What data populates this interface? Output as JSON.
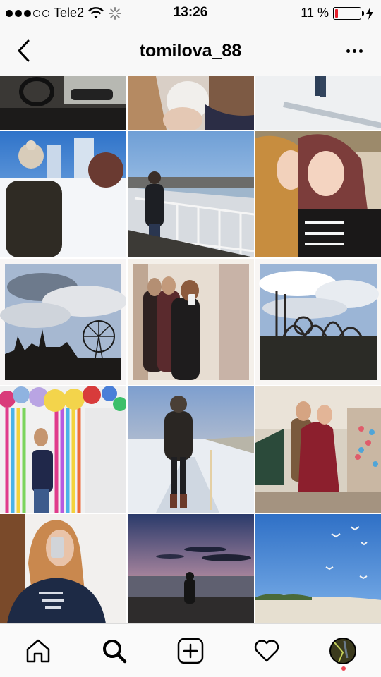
{
  "status_bar": {
    "carrier": "Tele2",
    "time": "13:26",
    "battery_percent": "11 %",
    "battery_level": 0.11,
    "signal_icons": [
      "signal-dots-icon",
      "wifi-icon",
      "activity-spinner-icon"
    ]
  },
  "nav": {
    "title": "tomilova_88",
    "back_icon": "chevron-left-icon",
    "more_icon": "more-horizontal-icon"
  },
  "grid": {
    "rows": [
      [
        "car-interior-photo",
        "girl-with-cup-photo",
        "snowy-walkway-photo"
      ],
      [
        "winter-city-back-view-photo",
        "embankment-railing-photo",
        "two-girls-selfie-photo"
      ],
      [
        "ferris-wheel-castle-photo",
        "mirror-selfie-three-girls-photo",
        "amusement-park-rides-photo"
      ],
      [
        "balloons-party-photo",
        "snow-path-woman-photo",
        "christmas-market-hug-photo"
      ],
      [
        "mirror-selfie-sweater-photo",
        "sunset-beach-photo",
        "seagulls-beach-photo"
      ]
    ]
  },
  "tab_bar": {
    "items": [
      "home-icon",
      "search-icon",
      "add-post-icon",
      "activity-heart-icon",
      "profile-avatar-icon"
    ],
    "active": "search-icon",
    "notification_color": "#ed4956"
  },
  "colors": {
    "battery_low": "#e4202c",
    "bar_background": "#f8f8f8"
  }
}
